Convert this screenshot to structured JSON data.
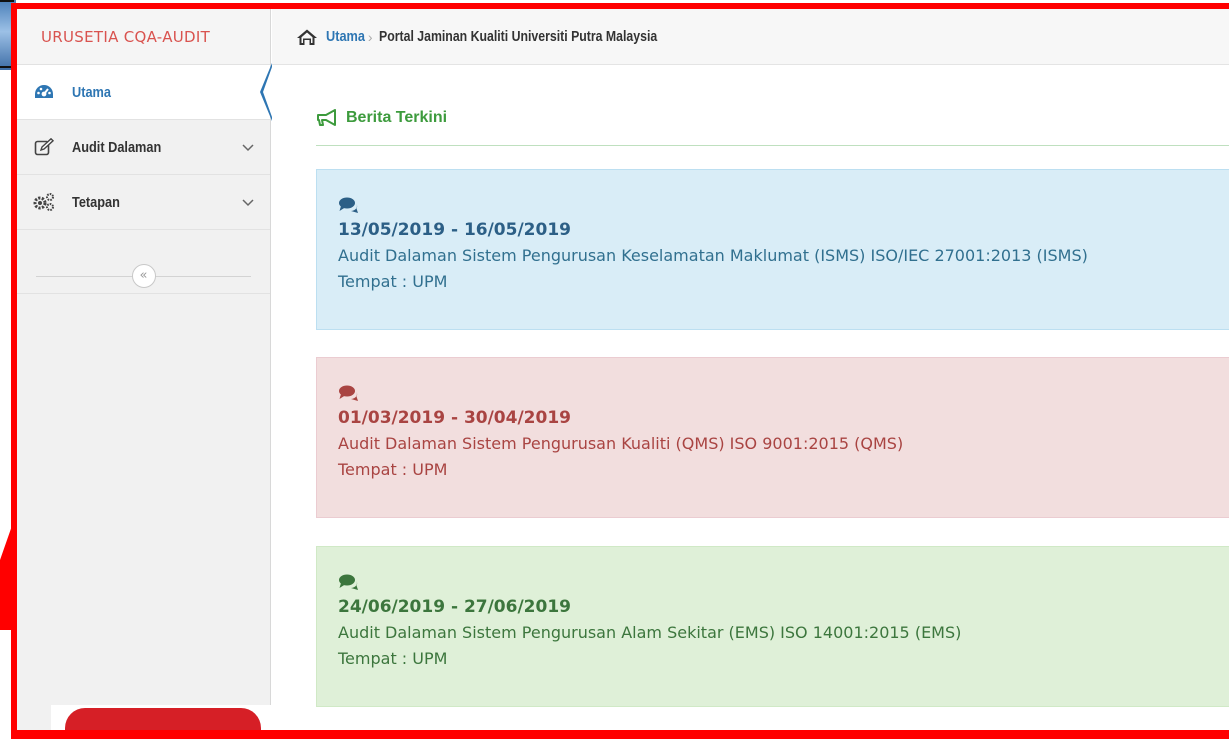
{
  "sidebar": {
    "brand": "URUSETIA CQA-AUDIT",
    "items": [
      {
        "label": "Utama",
        "icon": "dashboard-icon",
        "active": true
      },
      {
        "label": "Audit Dalaman",
        "icon": "edit-icon",
        "has_submenu": true
      },
      {
        "label": "Tetapan",
        "icon": "cogs-icon",
        "has_submenu": true
      }
    ],
    "collapse_glyph": "«"
  },
  "breadcrumb": {
    "home_icon": "home-icon",
    "home_label": "Utama",
    "current": "Portal Jaminan Kualiti Universiti Putra Malaysia"
  },
  "news_section": {
    "title": "Berita Terkini",
    "icon": "bullhorn-icon"
  },
  "news": [
    {
      "date": "13/05/2019 - 16/05/2019",
      "title": "Audit Dalaman Sistem Pengurusan Keselamatan Maklumat (ISMS) ISO/IEC 27001:2013 (ISMS)",
      "place": "Tempat : UPM",
      "style": "info"
    },
    {
      "date": "01/03/2019 - 30/04/2019",
      "title": "Audit Dalaman Sistem Pengurusan Kualiti (QMS) ISO 9001:2015 (QMS)",
      "place": "Tempat : UPM",
      "style": "danger"
    },
    {
      "date": "24/06/2019 - 27/06/2019",
      "title": "Audit Dalaman Sistem Pengurusan Alam Sekitar (EMS) ISO 14001:2015 (EMS)",
      "place": "Tempat : UPM",
      "style": "success"
    }
  ],
  "colors": {
    "highlight_frame": "#ff0000",
    "brand": "#d9534f",
    "link": "#2e76b3",
    "news_info_bg": "#d9edf7",
    "news_danger_bg": "#f2dede",
    "news_success_bg": "#dff0d8"
  }
}
